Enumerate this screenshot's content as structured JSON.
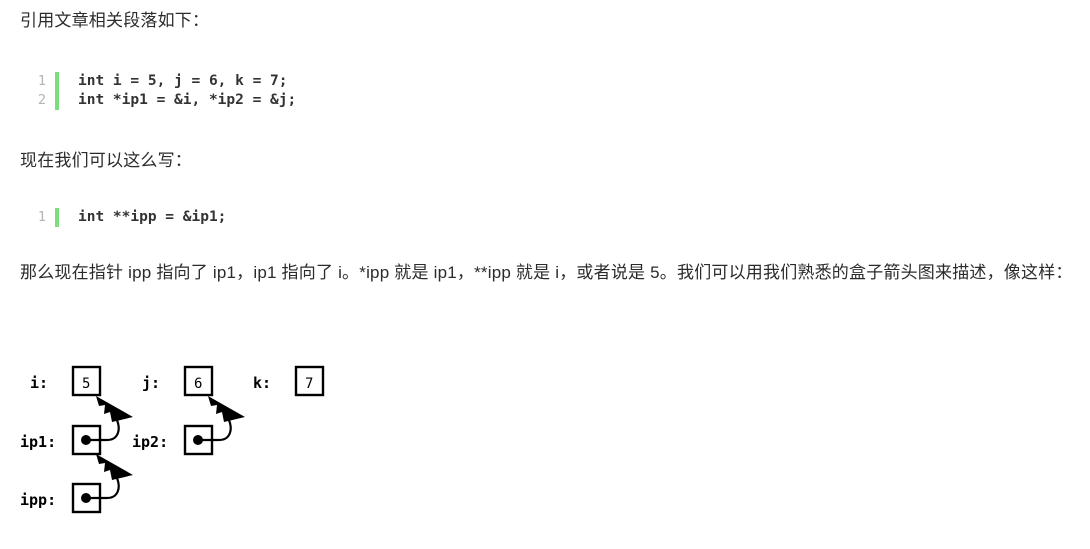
{
  "page": {
    "background_color": "#ffffff",
    "text_color": "#2b2b2b"
  },
  "intro_paragraph": "引用文章相关段落如下：",
  "second_paragraph": "现在我们可以这么写：",
  "explain_paragraph": "那么现在指针 ipp 指向了 ip1，ip1 指向了 i。*ipp 就是 ip1，**ipp 就是 i，或者说是 5。我们可以用我们熟悉的盒子箭头图来描述，像这样：",
  "code_blocks": [
    {
      "id": "code-block-1",
      "gutter_color": "#7ddc7d",
      "line_number_color": "#b4b4b4",
      "lines": [
        {
          "number": "1",
          "text": "int i = 5, j = 6, k = 7;"
        },
        {
          "number": "2",
          "text": "int *ip1 = &i, *ip2 = &j;"
        }
      ]
    },
    {
      "id": "code-block-2",
      "gutter_color": "#7ddc7d",
      "line_number_color": "#b4b4b4",
      "lines": [
        {
          "number": "1",
          "text": "int **ipp = &ip1;"
        }
      ]
    }
  ],
  "diagram": {
    "title": "box-and-arrow pointer diagram",
    "stroke_color": "#000000",
    "box_fill": "#ffffff",
    "nodes": [
      {
        "name": "i",
        "label": "i:",
        "value": "5",
        "kind": "value"
      },
      {
        "name": "j",
        "label": "j:",
        "value": "6",
        "kind": "value"
      },
      {
        "name": "k",
        "label": "k:",
        "value": "7",
        "kind": "value"
      },
      {
        "name": "ip1",
        "label": "ip1:",
        "value": "",
        "kind": "pointer"
      },
      {
        "name": "ip2",
        "label": "ip2:",
        "value": "",
        "kind": "pointer"
      },
      {
        "name": "ipp",
        "label": "ipp:",
        "value": "",
        "kind": "pointer"
      }
    ],
    "arrows": [
      {
        "from": "ip1",
        "to": "i"
      },
      {
        "from": "ip2",
        "to": "j"
      },
      {
        "from": "ipp",
        "to": "ip1"
      }
    ]
  }
}
